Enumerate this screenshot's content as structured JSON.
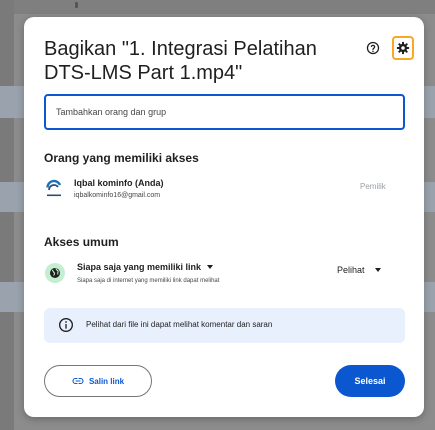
{
  "colors": {
    "accent": "#0b57d0",
    "highlight_border": "#f9a825",
    "info_bg": "#e8f0fe",
    "link_icon_bg": "#c4eed0"
  },
  "dialog": {
    "title": "Bagikan \"1. Integrasi Pelatihan DTS-LMS Part 1.mp4\"",
    "help_icon": "help-circle-icon",
    "settings_icon": "gear-icon"
  },
  "add_people": {
    "placeholder": "Tambahkan orang dan grup"
  },
  "people_section": {
    "label": "Orang yang memiliki akses",
    "owner": {
      "name": "Iqbal kominfo (Anda)",
      "email": "iqbalkominfo16@gmail.com",
      "role": "Pemilik",
      "avatar_icon": "kominfo-logo-avatar"
    }
  },
  "general_access": {
    "label": "Akses umum",
    "link_icon": "globe-icon",
    "option": "Siapa saja yang memiliki link",
    "description": "Siapa saja di internet yang memiliki link dapat melihat",
    "role": "Pelihat"
  },
  "info": {
    "icon": "info-icon",
    "text": "Pelihat dari file ini dapat melihat komentar dan saran"
  },
  "footer": {
    "copy_link_label": "Salin link",
    "copy_icon": "link-icon",
    "done_label": "Selesai"
  }
}
